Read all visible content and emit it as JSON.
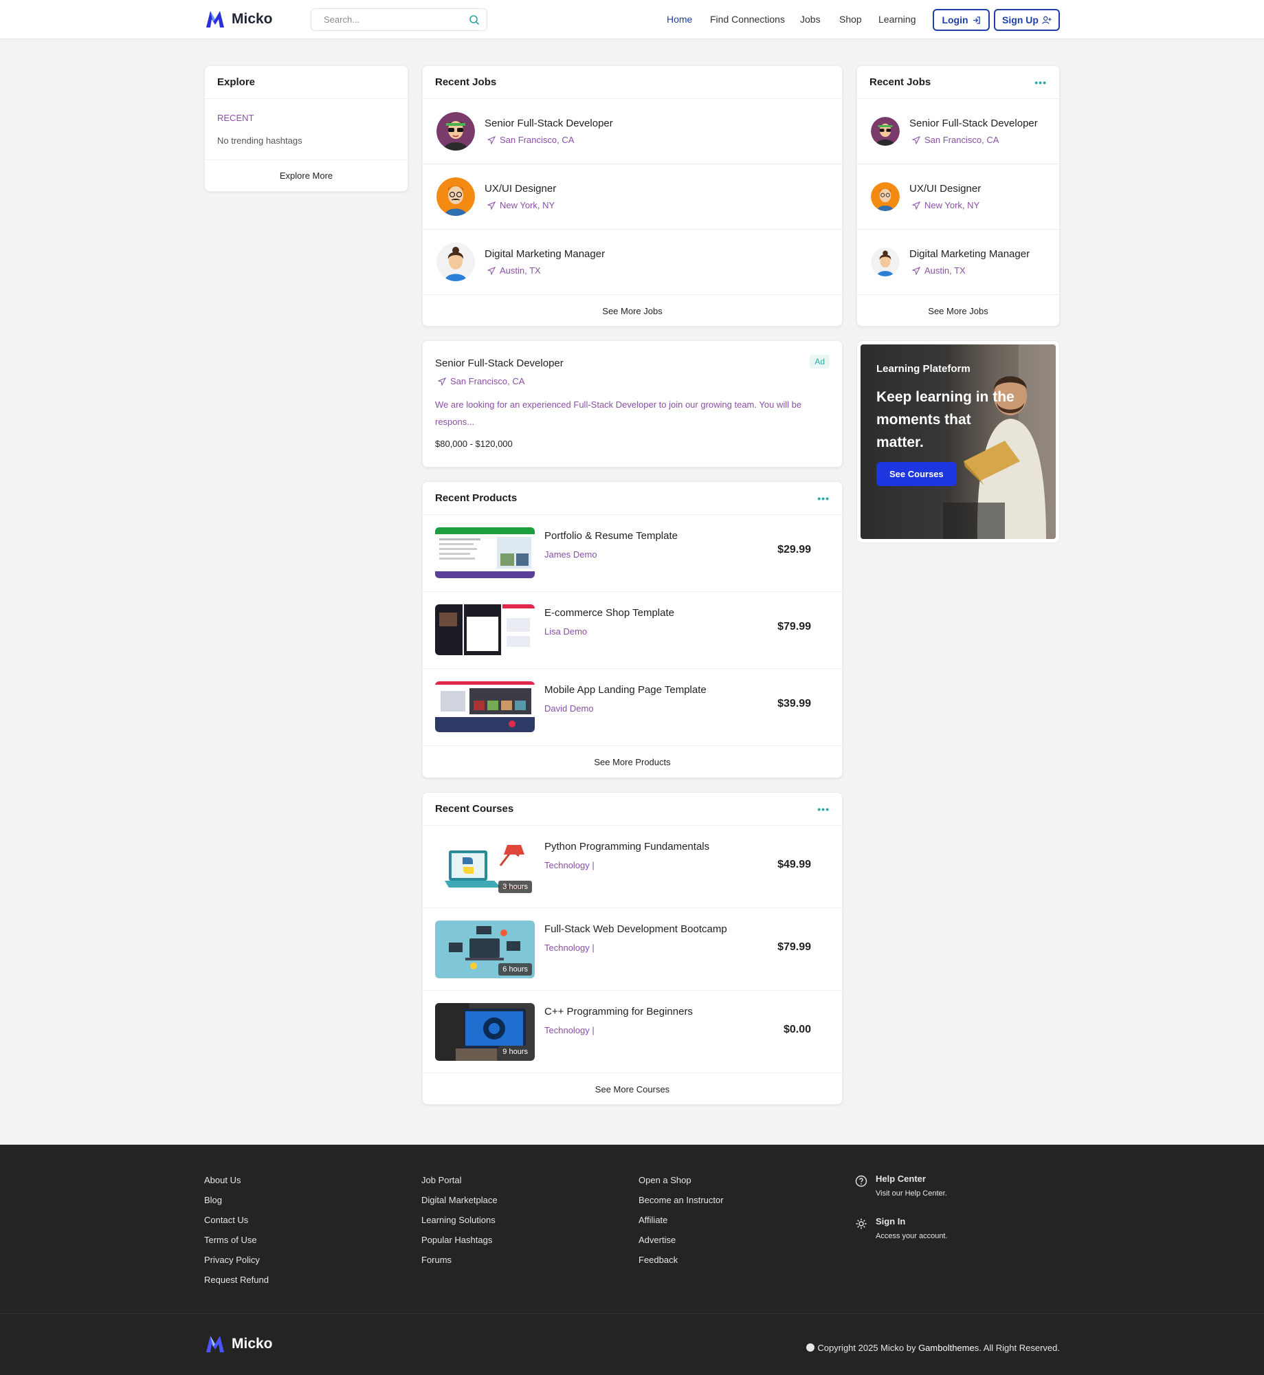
{
  "header": {
    "brand": "Micko",
    "search_placeholder": "Search...",
    "nav": [
      "Home",
      "Find Connections",
      "Jobs",
      "Shop",
      "Learning"
    ],
    "login": "Login",
    "signup": "Sign Up"
  },
  "explore": {
    "title": "Explore",
    "recent_label": "RECENT",
    "empty_text": "No trending hashtags",
    "more": "Explore More"
  },
  "recent_jobs_center": {
    "title": "Recent Jobs",
    "jobs": [
      {
        "title": "Senior Full-Stack Developer",
        "location": "San Francisco, CA"
      },
      {
        "title": "UX/UI Designer",
        "location": "New York, NY"
      },
      {
        "title": "Digital Marketing Manager",
        "location": "Austin, TX"
      }
    ],
    "more": "See More Jobs"
  },
  "recent_jobs_right": {
    "title": "Recent Jobs",
    "jobs": [
      {
        "title": "Senior Full-Stack Developer",
        "location": "San Francisco, CA"
      },
      {
        "title": "UX/UI Designer",
        "location": "New York, NY"
      },
      {
        "title": "Digital Marketing Manager",
        "location": "Austin, TX"
      }
    ],
    "more": "See More Jobs"
  },
  "ad": {
    "badge": "Ad",
    "title": "Senior Full-Stack Developer",
    "location": "San Francisco, CA",
    "description": "We are looking for an experienced Full-Stack Developer to join our growing team. You will be respons...",
    "salary": "$80,000 - $120,000"
  },
  "promo": {
    "eyebrow": "Learning Plateform",
    "heading": "Keep learning in the moments that matter.",
    "button": "See Courses"
  },
  "products": {
    "title": "Recent Products",
    "items": [
      {
        "title": "Portfolio & Resume Template",
        "author": "James Demo",
        "price": "$29.99"
      },
      {
        "title": "E-commerce Shop Template",
        "author": "Lisa Demo",
        "price": "$79.99"
      },
      {
        "title": "Mobile App Landing Page Template",
        "author": "David Demo",
        "price": "$39.99"
      }
    ],
    "more": "See More Products"
  },
  "courses": {
    "title": "Recent Courses",
    "items": [
      {
        "title": "Python Programming Fundamentals",
        "category": "Technology |",
        "price": "$49.99",
        "hours": "3 hours"
      },
      {
        "title": "Full-Stack Web Development Bootcamp",
        "category": "Technology |",
        "price": "$79.99",
        "hours": "6 hours"
      },
      {
        "title": "C++ Programming for Beginners",
        "category": "Technology |",
        "price": "$0.00",
        "hours": "9 hours"
      }
    ],
    "more": "See More Courses"
  },
  "footer": {
    "col1": [
      "About Us",
      "Blog",
      "Contact Us",
      "Terms of Use",
      "Privacy Policy",
      "Request Refund"
    ],
    "col2": [
      "Job Portal",
      "Digital Marketplace",
      "Learning Solutions",
      "Popular Hashtags",
      "Forums"
    ],
    "col3": [
      "Open a Shop",
      "Become an Instructor",
      "Affiliate",
      "Advertise",
      "Feedback"
    ],
    "help": [
      {
        "title": "Help Center",
        "subtitle": "Visit our Help Center."
      },
      {
        "title": "Sign In",
        "subtitle": "Access your account."
      }
    ],
    "brand": "Micko",
    "copyright_prefix": "Copyright 2025 Micko by ",
    "copyright_author": "Gamboltheme",
    "copyright_suffix": "s. All Right Reserved."
  },
  "colors": {
    "accent_blue": "#1e3ea8",
    "accent_teal": "#2aa7a0",
    "muted_purple": "#8a4fa6",
    "footer_bg": "#242424"
  }
}
